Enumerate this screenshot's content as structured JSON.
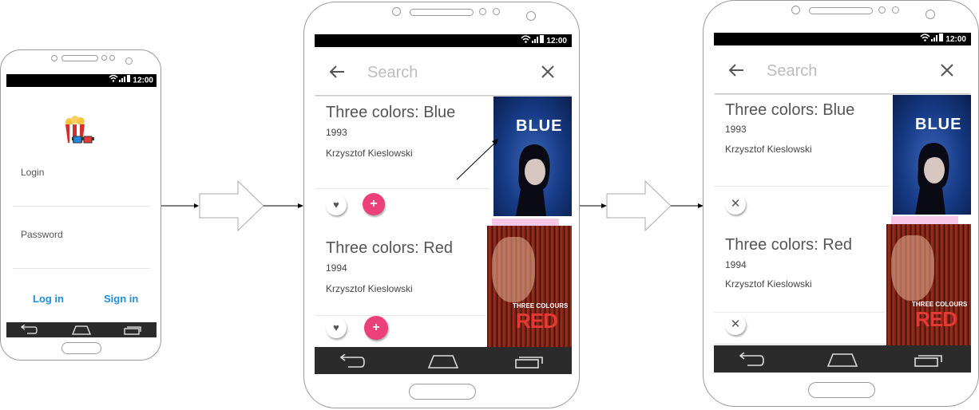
{
  "status_bar": {
    "time": "12:00"
  },
  "login_screen": {
    "login_label": "Login",
    "password_label": "Password",
    "login_button": "Log in",
    "signin_button": "Sign in"
  },
  "search_screen": {
    "placeholder": "Search",
    "movies": [
      {
        "title": "Three colors: Blue",
        "year": "1993",
        "director": "Krzysztof Kieslowski",
        "poster_text": "BLUE"
      },
      {
        "title": "Three colors: Red",
        "year": "1994",
        "director": "Krzysztof Kieslowski",
        "poster_caption": "THREE COLOURS",
        "poster_text": "RED"
      }
    ]
  },
  "icons": {
    "back": "arrow-left-icon",
    "clear": "close-icon",
    "like": "heart-icon",
    "add": "plus-icon",
    "remove": "close-icon",
    "app_logo": "popcorn-3d-glasses-icon"
  },
  "colors": {
    "accent_pink": "#ec407a",
    "link_blue": "#1f8fdf",
    "status_bar": "#000000",
    "nav_bar": "#2b2b2b"
  }
}
